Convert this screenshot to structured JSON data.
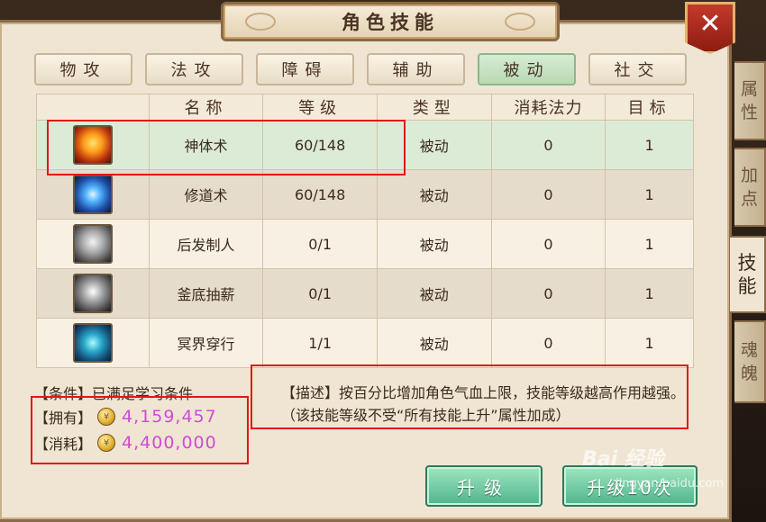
{
  "title": "角色技能",
  "close_label": "✕",
  "tabs": [
    {
      "label": "物攻",
      "active": false
    },
    {
      "label": "法攻",
      "active": false
    },
    {
      "label": "障碍",
      "active": false
    },
    {
      "label": "辅助",
      "active": false
    },
    {
      "label": "被动",
      "active": true
    },
    {
      "label": "社交",
      "active": false
    }
  ],
  "side_tabs": [
    {
      "label": "属性"
    },
    {
      "label": "加点"
    },
    {
      "label": "技能",
      "active": true
    },
    {
      "label": "魂魄"
    }
  ],
  "columns": [
    "名称",
    "等级",
    "类型",
    "消耗法力",
    "目标"
  ],
  "skills": [
    {
      "icon": "flame-figure-icon",
      "name": "神体术",
      "level": "60/148",
      "type": "被动",
      "mana": "0",
      "target": "1"
    },
    {
      "icon": "meditation-aura-icon",
      "name": "修道术",
      "level": "60/148",
      "type": "被动",
      "mana": "0",
      "target": "1"
    },
    {
      "icon": "grey-warrior-icon",
      "name": "后发制人",
      "level": "0/1",
      "type": "被动",
      "mana": "0",
      "target": "1"
    },
    {
      "icon": "grey-figure-icon",
      "name": "釜底抽薪",
      "level": "0/1",
      "type": "被动",
      "mana": "0",
      "target": "1"
    },
    {
      "icon": "beast-rider-icon",
      "name": "冥界穿行",
      "level": "1/1",
      "type": "被动",
      "mana": "0",
      "target": "1"
    }
  ],
  "condition": "【条件】已满足学习条件",
  "owned_label": "【拥有】",
  "owned_value": "4,159,457",
  "cost_label": "【消耗】",
  "cost_value": "4,400,000",
  "description": "【描述】按百分比增加角色气血上限，技能等级越高作用越强。（该技能等级不受“所有技能上升”属性加成）",
  "buttons": {
    "upgrade": "升级",
    "upgrade10": "升级10次"
  },
  "watermark": "Bai 经验",
  "watermark_url": "jingyan.baidu.com",
  "colors": {
    "highlight": "#e01818",
    "accent_green": "#4fb58c",
    "currency": "#d04ad6"
  }
}
